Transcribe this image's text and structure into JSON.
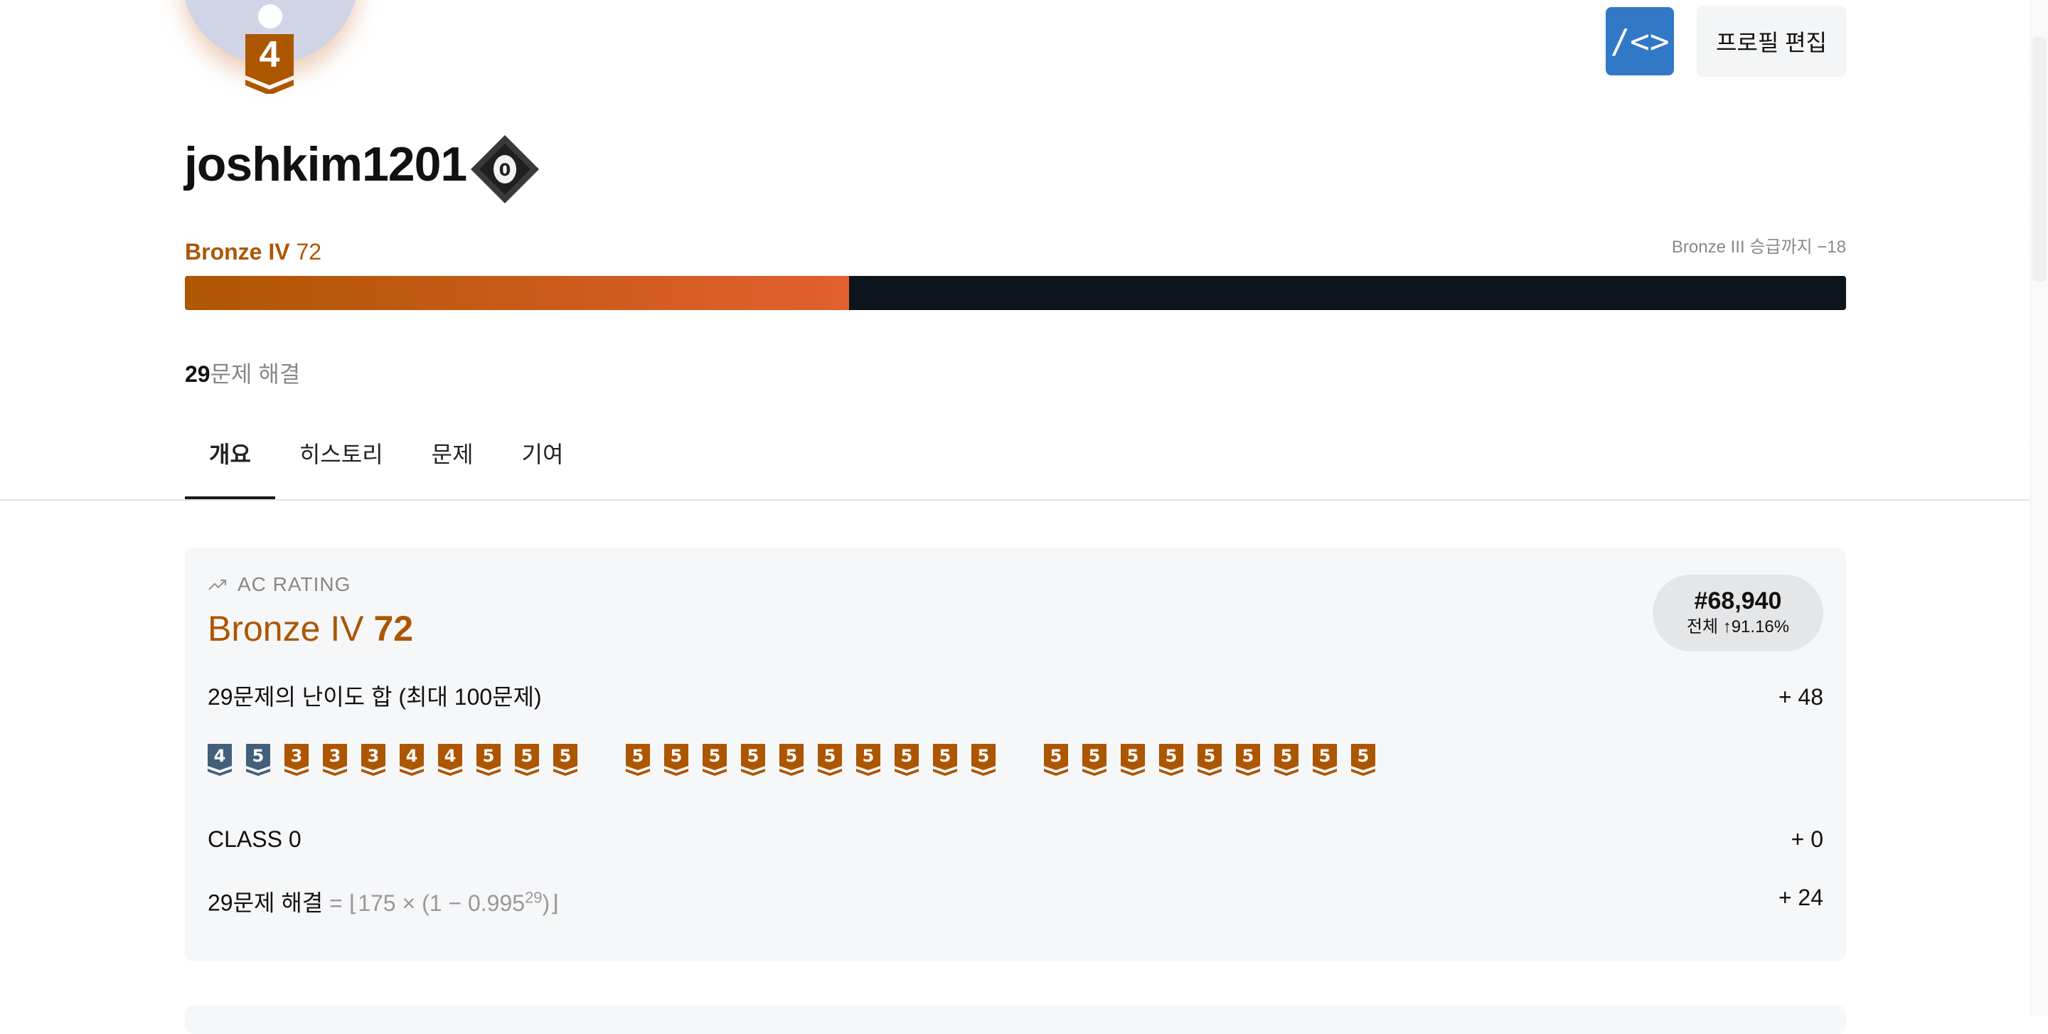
{
  "profile": {
    "avatar_tier_number": "4",
    "username": "joshkim1201",
    "class_badge_number": "0",
    "tier_name": "Bronze IV",
    "tier_rating": "72",
    "promotion_text": "Bronze III 승급까지 −18",
    "progress_fraction": 0.4,
    "solved_count": "29",
    "solved_suffix": "문제 해결"
  },
  "buttons": {
    "code_icon": "code-icon",
    "code_glyph": "/<>",
    "edit_label": "프로필 편집"
  },
  "tabs": [
    {
      "label": "개요",
      "active": true
    },
    {
      "label": "히스토리",
      "active": false
    },
    {
      "label": "문제",
      "active": false
    },
    {
      "label": "기여",
      "active": false
    }
  ],
  "rating_card": {
    "label": "AC RATING",
    "trend_icon": "trend-up-icon",
    "tier_name": "Bronze IV",
    "rating": "72",
    "rank": "#68,940",
    "rank_percentile": "전체 ↑91.16%",
    "difficulty_row": {
      "text": "29문제의 난이도 합 (최대 100문제)",
      "value": "+ 48"
    },
    "class_row": {
      "text": "CLASS 0",
      "value": "+ 0"
    },
    "solved_row": {
      "text": "29문제 해결",
      "formula_prefix": "= ⌊175 × (1 − 0.995",
      "formula_exp": "29",
      "formula_suffix": ")⌋",
      "value": "+ 24"
    },
    "problem_tier_badges": [
      {
        "tier": "silver",
        "level": "4"
      },
      {
        "tier": "silver",
        "level": "5"
      },
      {
        "tier": "bronze",
        "level": "3"
      },
      {
        "tier": "bronze",
        "level": "3"
      },
      {
        "tier": "bronze",
        "level": "3"
      },
      {
        "tier": "bronze",
        "level": "4"
      },
      {
        "tier": "bronze",
        "level": "4"
      },
      {
        "tier": "bronze",
        "level": "5"
      },
      {
        "tier": "bronze",
        "level": "5"
      },
      {
        "tier": "bronze",
        "level": "5"
      },
      {
        "tier": "bronze",
        "level": "5"
      },
      {
        "tier": "bronze",
        "level": "5"
      },
      {
        "tier": "bronze",
        "level": "5"
      },
      {
        "tier": "bronze",
        "level": "5"
      },
      {
        "tier": "bronze",
        "level": "5"
      },
      {
        "tier": "bronze",
        "level": "5"
      },
      {
        "tier": "bronze",
        "level": "5"
      },
      {
        "tier": "bronze",
        "level": "5"
      },
      {
        "tier": "bronze",
        "level": "5"
      },
      {
        "tier": "bronze",
        "level": "5"
      },
      {
        "tier": "bronze",
        "level": "5"
      },
      {
        "tier": "bronze",
        "level": "5"
      },
      {
        "tier": "bronze",
        "level": "5"
      },
      {
        "tier": "bronze",
        "level": "5"
      },
      {
        "tier": "bronze",
        "level": "5"
      },
      {
        "tier": "bronze",
        "level": "5"
      },
      {
        "tier": "bronze",
        "level": "5"
      },
      {
        "tier": "bronze",
        "level": "5"
      },
      {
        "tier": "bronze",
        "level": "5"
      }
    ]
  },
  "colors": {
    "bronze": "#ad5600",
    "silver": "#435f7a",
    "progress_end": "#e35f30",
    "accent_blue": "#3178c6"
  }
}
